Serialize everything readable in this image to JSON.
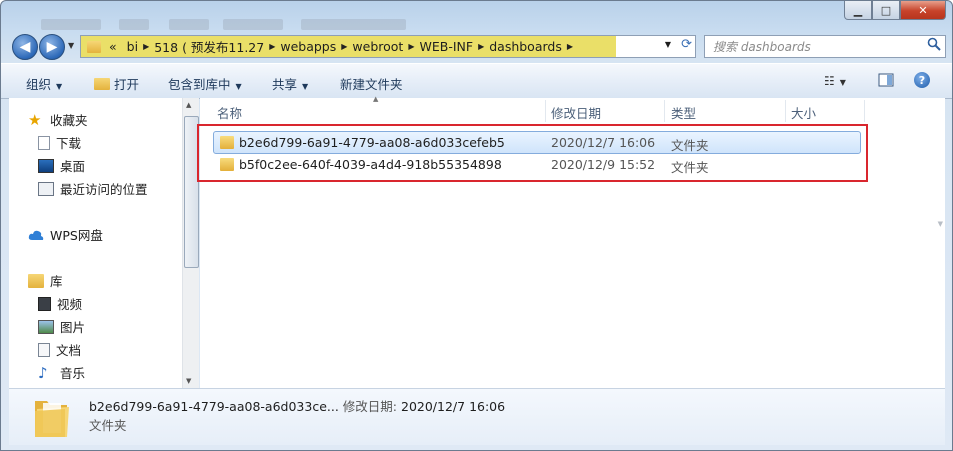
{
  "address": {
    "overflow": "«",
    "crumbs": [
      "bi",
      "518 ( 预发布11.27",
      "webapps",
      "webroot",
      "WEB-INF",
      "dashboards"
    ]
  },
  "search": {
    "placeholder": "搜索 dashboards"
  },
  "toolbar": {
    "organize": "组织",
    "open": "打开",
    "include_in_library": "包含到库中",
    "share": "共享",
    "new_folder": "新建文件夹"
  },
  "sidebar": {
    "favorites": "收藏夹",
    "downloads": "下载",
    "desktop": "桌面",
    "recent": "最近访问的位置",
    "wps": "WPS网盘",
    "libraries": "库",
    "videos": "视频",
    "pictures": "图片",
    "documents": "文档",
    "music": "音乐"
  },
  "columns": {
    "name": "名称",
    "modified": "修改日期",
    "type": "类型",
    "size": "大小"
  },
  "files": [
    {
      "name": "b2e6d799-6a91-4779-aa08-a6d033cefeb5",
      "modified": "2020/12/7 16:06",
      "type": "文件夹",
      "size": ""
    },
    {
      "name": "b5f0c2ee-640f-4039-a4d4-918b55354898",
      "modified": "2020/12/9 15:52",
      "type": "文件夹",
      "size": ""
    }
  ],
  "details": {
    "name": "b2e6d799-6a91-4779-aa08-a6d033ce...",
    "modified_label": "修改日期:",
    "modified": "2020/12/7 16:06",
    "type": "文件夹"
  },
  "colors": {
    "highlight": "#eadf68",
    "annotation_box": "#d9262e",
    "selection": "#cfe4fb"
  }
}
